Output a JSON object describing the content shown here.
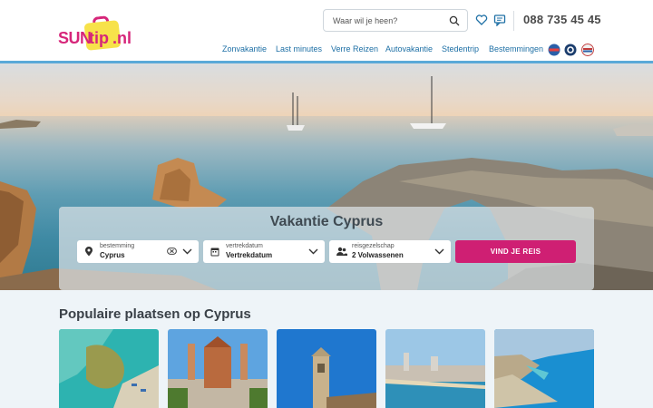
{
  "logo": {
    "sun": "SUN",
    "tip": "tip",
    "nl": ".nl"
  },
  "search": {
    "placeholder": "Waar wil je heen?"
  },
  "header": {
    "phone": "088 735 45 45"
  },
  "nav": {
    "items": [
      {
        "label": "Zonvakantie"
      },
      {
        "label": "Last minutes"
      },
      {
        "label": "Verre Reizen"
      },
      {
        "label": "Autovakantie"
      },
      {
        "label": "Stedentrip"
      },
      {
        "label": "Bestemmingen"
      }
    ]
  },
  "hero": {
    "title": "Vakantie Cyprus",
    "fields": {
      "destination": {
        "label": "bestemming",
        "value": "Cyprus",
        "icon": "location-pin-icon"
      },
      "departure": {
        "label": "vertrekdatum",
        "value": "Vertrekdatum",
        "icon": "calendar-icon"
      },
      "party": {
        "label": "reisgezelschap",
        "value": "2 Volwassenen",
        "icon": "people-icon"
      }
    },
    "cta_label": "VIND JE REIS"
  },
  "popular": {
    "title": "Populaire plaatsen op Cyprus"
  },
  "colors": {
    "brand": "#cf1f73",
    "nav": "#1d6fa5",
    "accent_bar": "#5aa9d8"
  }
}
